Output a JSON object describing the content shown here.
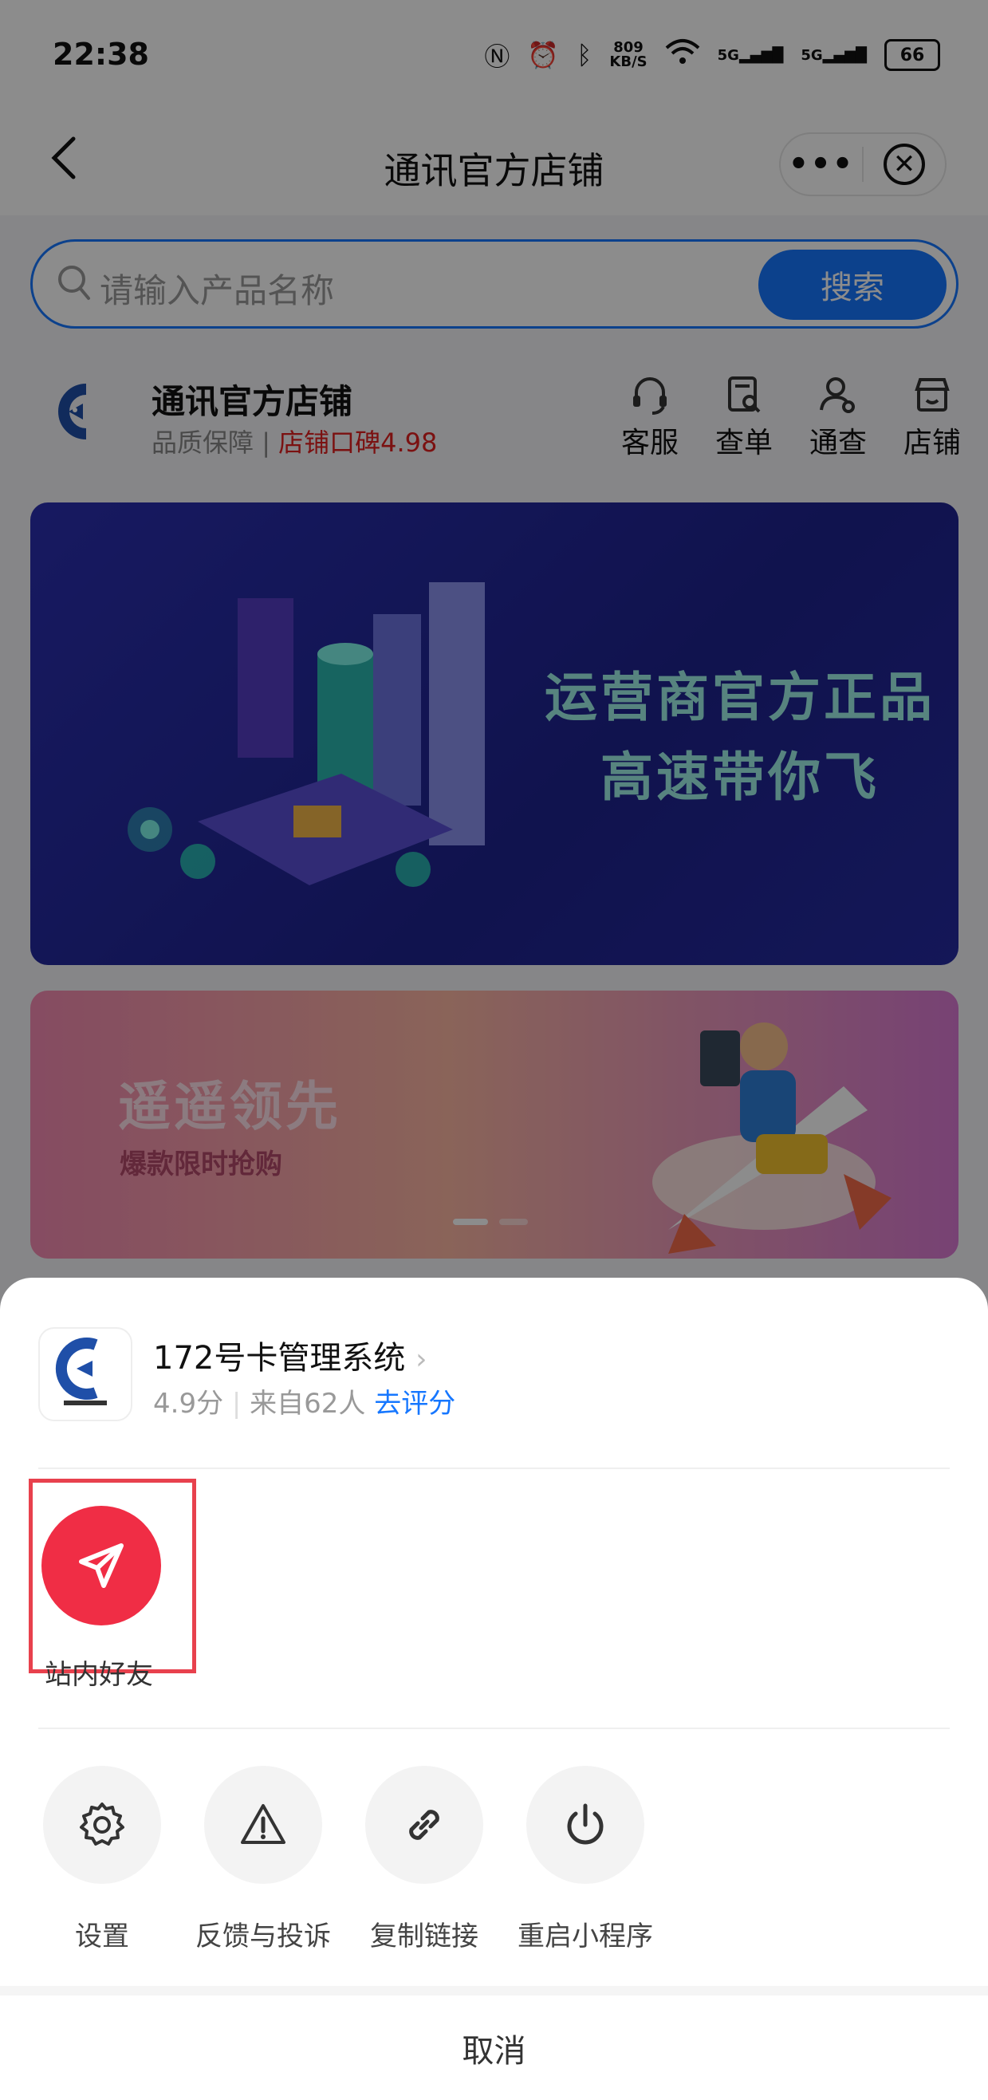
{
  "status": {
    "time": "22:38",
    "speed": "809\nKB/S",
    "battery": "66",
    "net1": "5G",
    "net2": "5G"
  },
  "nav": {
    "title": "通讯官方店铺",
    "more": "•••"
  },
  "search": {
    "placeholder": "请输入产品名称",
    "button": "搜索"
  },
  "shop": {
    "name": "通讯官方店铺",
    "quality": "品质保障",
    "divider": "|",
    "rating": "店铺口碑4.98",
    "actions": [
      {
        "label": "客服",
        "icon": "headset-icon"
      },
      {
        "label": "查单",
        "icon": "order-search-icon"
      },
      {
        "label": "通查",
        "icon": "user-search-icon"
      },
      {
        "label": "店铺",
        "icon": "store-icon"
      }
    ]
  },
  "banner1": {
    "line1": "运营商官方正品",
    "line2": "高速带你飞"
  },
  "banner2": {
    "title": "遥遥领先",
    "subtitle": "爆款限时抢购"
  },
  "sheet": {
    "app_name": "172号卡管理系统",
    "score": "4.9分",
    "from": "来自62人",
    "rate_link": "去评分",
    "share_label": "站内好友",
    "tools": [
      {
        "label": "设置",
        "icon": "gear-icon"
      },
      {
        "label": "反馈与投诉",
        "icon": "warning-icon"
      },
      {
        "label": "复制链接",
        "icon": "link-icon"
      },
      {
        "label": "重启小程序",
        "icon": "power-icon"
      }
    ],
    "cancel": "取消"
  },
  "colors": {
    "accent": "#1677ff",
    "share": "#f02d45",
    "highlight": "#e8414d",
    "rating": "#e02020"
  }
}
